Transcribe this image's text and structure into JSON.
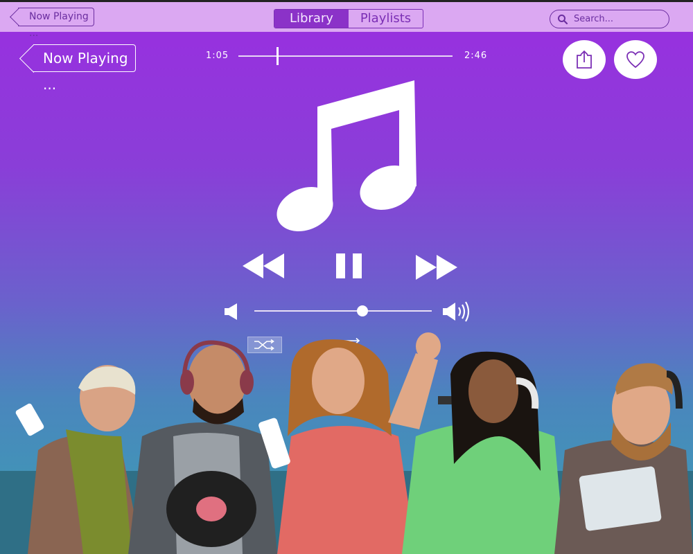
{
  "topbar": {
    "back_label": "Now Playing ...",
    "tabs": [
      {
        "label": "Library",
        "active": true
      },
      {
        "label": "Playlists",
        "active": false
      }
    ],
    "search": {
      "placeholder": "Search..."
    }
  },
  "player": {
    "back_label": "Now Playing ...",
    "elapsed": "1:05",
    "duration": "2:46",
    "progress": 0.18,
    "volume": 0.61,
    "shuffle_on": true,
    "repeat_on": false
  },
  "icons": {
    "share": "share-icon",
    "favorite": "heart-icon",
    "note": "music-note-icon",
    "rewind": "rewind-icon",
    "pause": "pause-icon",
    "forward": "fast-forward-icon",
    "vol_low": "volume-low-icon",
    "vol_high": "volume-high-icon",
    "shuffle": "shuffle-icon",
    "repeat": "repeat-icon"
  },
  "colors": {
    "topbar": "#dba8f2",
    "accent": "#8b32c8",
    "gradient_top": "#9a2ee0",
    "gradient_bottom": "#3a9fb3"
  }
}
